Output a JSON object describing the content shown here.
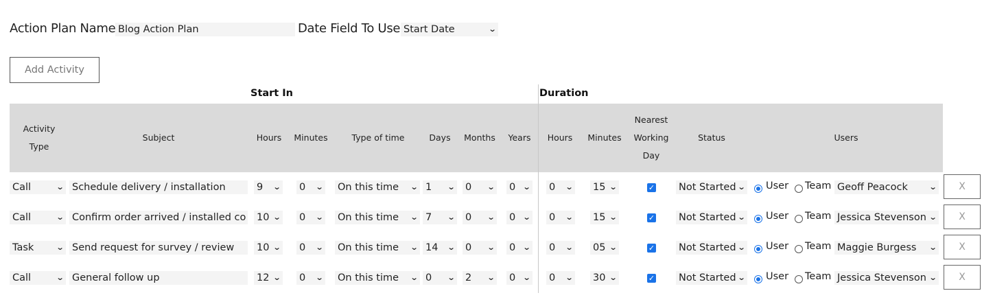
{
  "form": {
    "plan_name_label": "Action Plan Name",
    "plan_name_value": "Blog Action Plan",
    "date_field_label": "Date Field To Use",
    "date_field_value": "Start Date",
    "add_activity_label": "Add Activity"
  },
  "groups": {
    "start_in": "Start In",
    "duration": "Duration"
  },
  "headers": {
    "activity_type_1": "Activity",
    "activity_type_2": "Type",
    "subject": "Subject",
    "hours": "Hours",
    "minutes": "Minutes",
    "type_of_time": "Type of time",
    "days": "Days",
    "months": "Months",
    "years": "Years",
    "dur_hours": "Hours",
    "dur_minutes": "Minutes",
    "nearest_1": "Nearest",
    "nearest_2": "Working",
    "nearest_3": "Day",
    "status": "Status",
    "users": "Users"
  },
  "radio_labels": {
    "user": "User",
    "team": "Team"
  },
  "delete_label": "X",
  "colors": {
    "header_bg": "#dadada",
    "accent": "#1a73e8"
  },
  "rows": [
    {
      "type": "Call",
      "subject": "Schedule delivery / installation",
      "hours": "9",
      "minutes": "0",
      "type_of_time": "On this time",
      "days": "1",
      "months": "0",
      "years": "0",
      "dur_hours": "0",
      "dur_minutes": "15",
      "nearest_working_day": true,
      "status": "Not Started",
      "assign": "User",
      "user": "Geoff Peacock"
    },
    {
      "type": "Call",
      "subject": "Confirm order arrived / installed co",
      "hours": "10",
      "minutes": "0",
      "type_of_time": "On this time",
      "days": "7",
      "months": "0",
      "years": "0",
      "dur_hours": "0",
      "dur_minutes": "15",
      "nearest_working_day": true,
      "status": "Not Started",
      "assign": "User",
      "user": "Jessica Stevenson"
    },
    {
      "type": "Task",
      "subject": "Send request for survey / review",
      "hours": "10",
      "minutes": "0",
      "type_of_time": "On this time",
      "days": "14",
      "months": "0",
      "years": "0",
      "dur_hours": "0",
      "dur_minutes": "05",
      "nearest_working_day": true,
      "status": "Not Started",
      "assign": "User",
      "user": "Maggie Burgess"
    },
    {
      "type": "Call",
      "subject": "General follow up",
      "hours": "12",
      "minutes": "0",
      "type_of_time": "On this time",
      "days": "0",
      "months": "2",
      "years": "0",
      "dur_hours": "0",
      "dur_minutes": "30",
      "nearest_working_day": true,
      "status": "Not Started",
      "assign": "User",
      "user": "Jessica Stevenson"
    }
  ]
}
